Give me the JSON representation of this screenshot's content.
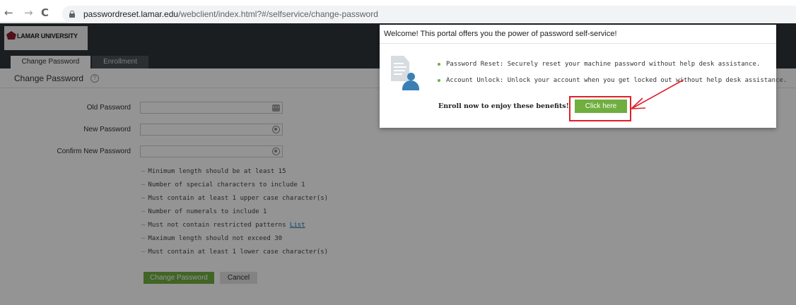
{
  "browser": {
    "url_host": "passwordreset.lamar.edu",
    "url_path": "/webclient/index.html?#/selfservice/change-password",
    "back_glyph": "←",
    "forward_glyph": "→",
    "reload_glyph": "C"
  },
  "header": {
    "logo_text": "LAMAR UNIVERSITY",
    "tabs": [
      {
        "label": "Change Password",
        "active": true
      },
      {
        "label": "Enrollment",
        "active": false
      }
    ]
  },
  "form": {
    "title": "Change Password",
    "help_glyph": "?",
    "fields": [
      {
        "label": "Old Password",
        "value": ""
      },
      {
        "label": "New Password",
        "value": ""
      },
      {
        "label": "Confirm New Password",
        "value": ""
      }
    ],
    "rules": [
      {
        "text": "Minimum length should be at least 15"
      },
      {
        "text": "Number of special characters to include 1"
      },
      {
        "text": "Must contain at least 1 upper case character(s)"
      },
      {
        "text": "Number of numerals to include 1"
      },
      {
        "text": "Must not contain restricted patterns",
        "link": "List"
      },
      {
        "text": "Maximum length should not exceed 30"
      },
      {
        "text": "Must contain at least 1 lower case character(s)"
      }
    ],
    "rule_dash": "—",
    "submit_label": "Change Password",
    "cancel_label": "Cancel"
  },
  "popup": {
    "title": "Welcome! This portal offers you the power of password self-service!",
    "benefits": [
      "Password Reset: Securely reset your machine password without help desk assistance.",
      "Account Unlock: Unlock your account when you get locked out without help desk assistance."
    ],
    "enroll_text": "Enroll now to enjoy these benefits!",
    "cta_label": "Click here"
  },
  "colors": {
    "header_bg": "#2e3438",
    "accent_green": "#6fae3f",
    "annotation_red": "#e0202a"
  }
}
